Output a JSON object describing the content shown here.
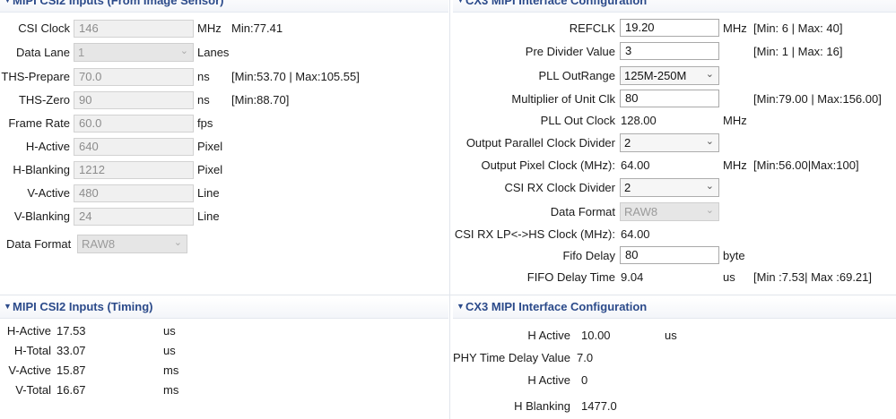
{
  "sections": {
    "csi2_inputs_title": "MIPI CSI2 Inputs (From Image Sensor)",
    "cx3_config_title": "CX3 MIPI Interface Configuration",
    "timing_title": "MIPI CSI2 Inputs (Timing)",
    "cx3_config2_title": "CX3 MIPI Interface Configuration"
  },
  "csi2_inputs": {
    "csi_clock": {
      "label": "CSI Clock",
      "value": "146",
      "unit": "MHz",
      "range": "Min:77.41"
    },
    "data_lane": {
      "label": "Data Lane",
      "value": "1",
      "unit": "Lanes"
    },
    "ths_prepare": {
      "label": "THS-Prepare",
      "value": "70.0",
      "unit": "ns",
      "range": "[Min:53.70 | Max:105.55]"
    },
    "ths_zero": {
      "label": "THS-Zero",
      "value": "90",
      "unit": "ns",
      "range": "[Min:88.70]"
    },
    "frame_rate": {
      "label": "Frame Rate",
      "value": "60.0",
      "unit": "fps"
    },
    "h_active": {
      "label": "H-Active",
      "value": "640",
      "unit": "Pixel"
    },
    "h_blanking": {
      "label": "H-Blanking",
      "value": "1212",
      "unit": "Pixel"
    },
    "v_active": {
      "label": "V-Active",
      "value": "480",
      "unit": "Line"
    },
    "v_blanking": {
      "label": "V-Blanking",
      "value": "24",
      "unit": "Line"
    },
    "data_format": {
      "label": "Data Format",
      "value": "RAW8"
    }
  },
  "cx3_config": {
    "refclk": {
      "label": "REFCLK",
      "value": "19.20",
      "unit": "MHz",
      "range": "[Min: 6 | Max: 40]"
    },
    "pre_divider": {
      "label": "Pre Divider Value",
      "value": "3",
      "range": "[Min: 1 | Max: 16]"
    },
    "pll_outrange": {
      "label": "PLL OutRange",
      "value": "125M-250M"
    },
    "multiplier": {
      "label": "Multiplier of Unit Clk",
      "value": "80",
      "range": "[Min:79.00 | Max:156.00]"
    },
    "pll_out_clock": {
      "label": "PLL Out Clock",
      "value": "128.00",
      "unit": "MHz"
    },
    "output_parallel_divider": {
      "label": "Output Parallel Clock Divider",
      "value": "2"
    },
    "output_pixel_clock": {
      "label": "Output Pixel Clock (MHz):",
      "value": "64.00",
      "unit": "MHz",
      "range": "[Min:56.00|Max:100]"
    },
    "csi_rx_divider": {
      "label": "CSI RX Clock Divider",
      "value": "2"
    },
    "data_format": {
      "label": "Data Format",
      "value": "RAW8"
    },
    "csi_rx_lp_hs": {
      "label": "CSI RX LP<->HS Clock  (MHz):",
      "value": "64.00"
    },
    "fifo_delay": {
      "label": "Fifo Delay",
      "value": "80",
      "unit": "byte"
    },
    "fifo_delay_time": {
      "label": "FIFO Delay Time",
      "value": "9.04",
      "unit": "us",
      "range": "[Min :7.53| Max :69.21]"
    }
  },
  "timing": {
    "h_active": {
      "label": "H-Active",
      "value": "17.53",
      "unit": "us"
    },
    "h_total": {
      "label": "H-Total",
      "value": "33.07",
      "unit": "us"
    },
    "v_active": {
      "label": "V-Active",
      "value": "15.87",
      "unit": "ms"
    },
    "v_total": {
      "label": "V-Total",
      "value": "16.67",
      "unit": "ms"
    }
  },
  "cx3_config2": {
    "h_active": {
      "label": "H Active",
      "value": "10.00",
      "unit": "us"
    },
    "phy_time_delay": {
      "label": "PHY Time Delay Value",
      "value": "7.0"
    },
    "h_active2": {
      "label": "H Active",
      "value": "0"
    },
    "h_blanking": {
      "label": "H Blanking",
      "value": "1477.0"
    }
  },
  "icons": {
    "twistie": "triangle-down-icon",
    "dropdown": "chevron-down-icon"
  },
  "colors": {
    "section_title": "#2b4a8a",
    "disabled_field": "#f0f0f0"
  }
}
